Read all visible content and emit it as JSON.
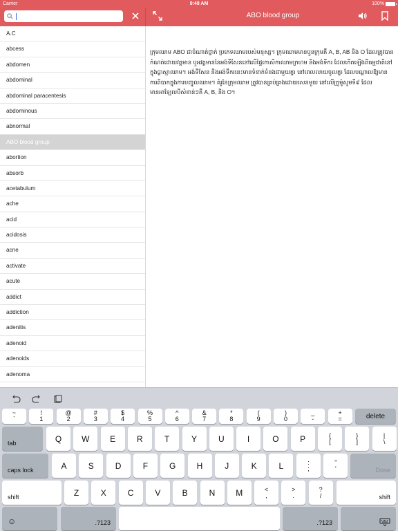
{
  "status": {
    "carrier": "Carrier",
    "time": "9:48 AM",
    "battery": "100%"
  },
  "search": {
    "value": "",
    "placeholder": ""
  },
  "header": {
    "title": "ABO blood group"
  },
  "words": [
    {
      "label": "A.C",
      "selected": false
    },
    {
      "label": "abcess",
      "selected": false
    },
    {
      "label": "abdomen",
      "selected": false
    },
    {
      "label": "abdominal",
      "selected": false
    },
    {
      "label": "abdominal paracentesis",
      "selected": false
    },
    {
      "label": "abdominous",
      "selected": false
    },
    {
      "label": "abnormal",
      "selected": false
    },
    {
      "label": "ABO blood group",
      "selected": true
    },
    {
      "label": "abortion",
      "selected": false
    },
    {
      "label": "absorb",
      "selected": false
    },
    {
      "label": "acetabulum",
      "selected": false
    },
    {
      "label": "ache",
      "selected": false
    },
    {
      "label": "acid",
      "selected": false
    },
    {
      "label": "acidosis",
      "selected": false
    },
    {
      "label": "acne",
      "selected": false
    },
    {
      "label": "activate",
      "selected": false
    },
    {
      "label": "acute",
      "selected": false
    },
    {
      "label": "addict",
      "selected": false
    },
    {
      "label": "addiction",
      "selected": false
    },
    {
      "label": "adenitis",
      "selected": false
    },
    {
      "label": "adenoid",
      "selected": false
    },
    {
      "label": "adenoids",
      "selected": false
    },
    {
      "label": "adenoma",
      "selected": false
    }
  ],
  "definition": "ក្រុមឈាម ABO ជាចំណាត់ថ្នាក់ ប្រភេទឈាមរបស់មនុស្ស។ ក្រុមឈាមមានបួនក្រុមគឺ A, B, AB និង O ដែលត្រូវបានកំណត់ដោយវត្តមាន ឬអវត្តមាននៃអង់ទីសែននៅលើផ្ទៃកោសិកាឈាមក្រហម និងអង់ទីករ ដែលកើតឡើងពីធម្មជាតិនៅក្នុងប្លាស្មាឈាម។ អង់ទីសែន និងអង់ទីករនេះមានទំនាក់ទំនងជាមួយគ្នា នៅពេលលាយចូលគ្នា ដែលបណ្តាលឱ្យមានការពិបាកក្នុងការបញ្ចូលឈាម។ គំរូនៃក្រុមឈាម ត្រូវបានគ្រប់គ្រងដោយសេនមួយ នៅលើក្រូម៉ូសូមទី៩ ដែលមានអាឡែលបីសំខាន់ៗគឺ A, B, និង O។",
  "keyboard": {
    "number_row": [
      {
        "top": "~",
        "bottom": "`"
      },
      {
        "top": "!",
        "bottom": "1"
      },
      {
        "top": "@",
        "bottom": "2"
      },
      {
        "top": "#",
        "bottom": "3"
      },
      {
        "top": "$",
        "bottom": "4"
      },
      {
        "top": "%",
        "bottom": "5"
      },
      {
        "top": "^",
        "bottom": "6"
      },
      {
        "top": "&",
        "bottom": "7"
      },
      {
        "top": "*",
        "bottom": "8"
      },
      {
        "top": "(",
        "bottom": "9"
      },
      {
        "top": ")",
        "bottom": "0"
      },
      {
        "top": "_",
        "bottom": "-"
      },
      {
        "top": "+",
        "bottom": "="
      }
    ],
    "delete": "delete",
    "tab": "tab",
    "row1": [
      "Q",
      "W",
      "E",
      "R",
      "T",
      "Y",
      "U",
      "I",
      "O",
      "P"
    ],
    "row1_extra": [
      {
        "top": "{",
        "bottom": "["
      },
      {
        "top": "}",
        "bottom": "]"
      },
      {
        "top": "|",
        "bottom": "\\"
      }
    ],
    "caps": "caps lock",
    "row2": [
      "A",
      "S",
      "D",
      "F",
      "G",
      "H",
      "J",
      "K",
      "L"
    ],
    "row2_extra": [
      {
        "top": ":",
        "bottom": ";"
      },
      {
        "top": "\"",
        "bottom": "'"
      }
    ],
    "done": "Done",
    "shift": "shift",
    "row3": [
      "Z",
      "X",
      "C",
      "V",
      "B",
      "N",
      "M"
    ],
    "row3_extra": [
      {
        "top": "<",
        "bottom": ","
      },
      {
        "top": ">",
        "bottom": "."
      },
      {
        "top": "?",
        "bottom": "/"
      }
    ],
    "numbers": ".?123",
    "emoji": "☺"
  },
  "icons": {
    "search": "search-icon",
    "clear": "close-icon",
    "expand": "expand-icon",
    "speaker": "speaker-icon",
    "bookmark": "bookmark-icon",
    "undo": "undo-icon",
    "redo": "redo-icon",
    "paste": "paste-icon",
    "hide_keyboard": "keyboard-hide-icon"
  },
  "colors": {
    "accent": "#e05a5e",
    "selected_row": "#d4d4d4",
    "keyboard_bg": "#d1d5db"
  }
}
